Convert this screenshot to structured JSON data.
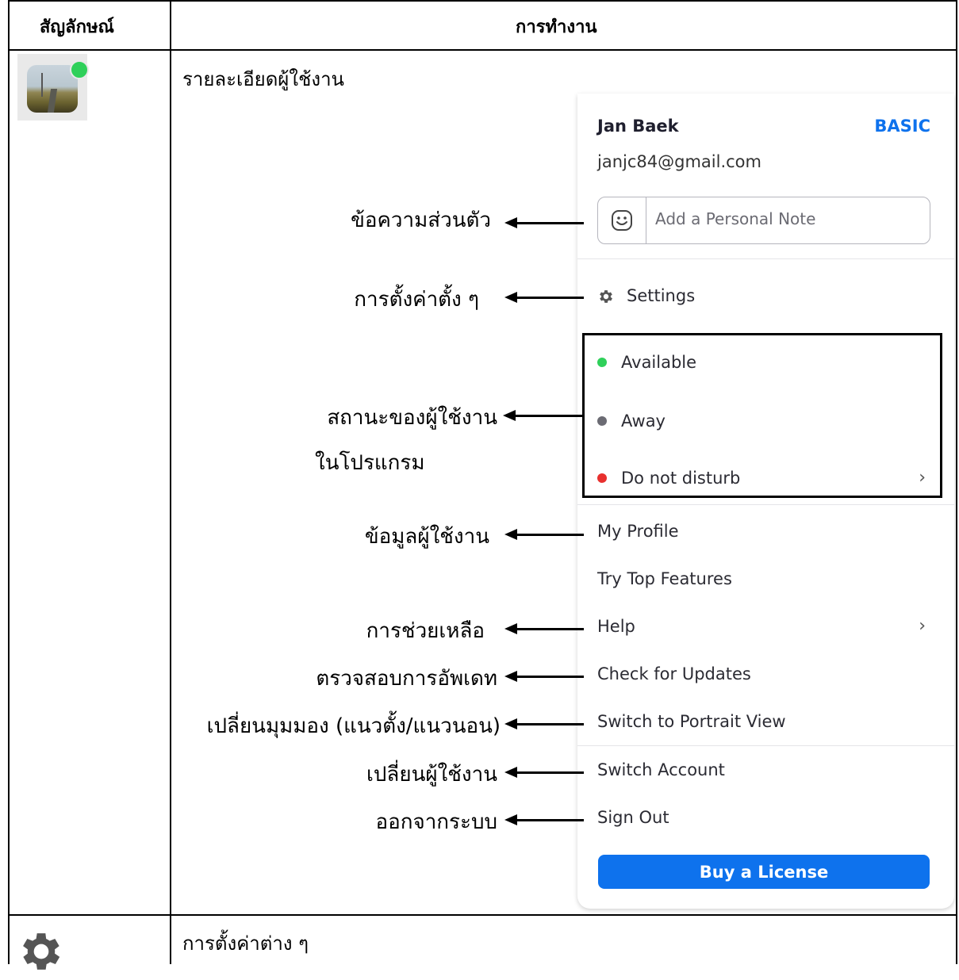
{
  "table": {
    "header_symbol": "สัญลักษณ์",
    "header_function": "การทำงาน"
  },
  "rows": [
    {
      "icon": "profile-avatar-icon",
      "description": "รายละเอียดผู้ใช้งาน"
    },
    {
      "icon": "gear-icon",
      "description": "การตั้งค่าต่าง ๆ"
    }
  ],
  "menu": {
    "user_name": "Jan Baek",
    "plan": "BASIC",
    "email": "janjc84@gmail.com",
    "note_placeholder": "Add a Personal Note",
    "settings": "Settings",
    "status": {
      "available": "Available",
      "away": "Away",
      "dnd": "Do not disturb"
    },
    "my_profile": "My Profile",
    "try_top_features": "Try Top Features",
    "help": "Help",
    "check_updates": "Check for Updates",
    "portrait_view": "Switch to Portrait View",
    "switch_account": "Switch Account",
    "sign_out": "Sign Out",
    "buy_license": "Buy a License"
  },
  "annotations": {
    "personal_note": "ข้อความส่วนตัว",
    "settings": "การตั้งค่าตั้ง ๆ",
    "status_line1": "สถานะของผู้ใช้งาน",
    "status_line2": "ในโปรแกรม",
    "profile": "ข้อมูลผู้ใช้งาน",
    "help": "การช่วยเหลือ",
    "updates": "ตรวจสอบการอัพเดท",
    "view": "เปลี่ยนมุมมอง (แนวตั้ง/แนวนอน)",
    "switch_user": "เปลี่ยนผู้ใช้งาน",
    "sign_out": "ออกจากระบบ"
  },
  "colors": {
    "brand_blue": "#0e72ed",
    "available": "#2fd05a",
    "away": "#6b6b73",
    "dnd": "#e8302e"
  }
}
